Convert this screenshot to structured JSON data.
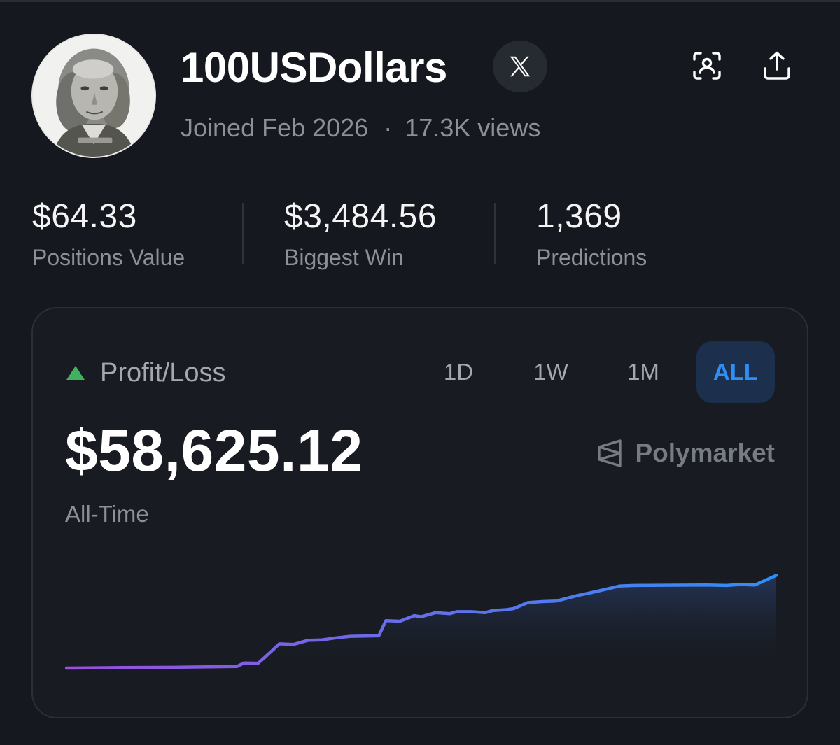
{
  "profile": {
    "username": "100USDollars",
    "joined": "Joined Feb 2026",
    "separator": "·",
    "views": "17.3K views"
  },
  "icons": {
    "avatar": "benjamin-franklin-portrait",
    "x_badge": "x-logo-icon",
    "scan": "face-scan-icon",
    "share": "share-upload-icon",
    "pl_trend": "triangle-up-icon",
    "brand": "polymarket-logo-icon"
  },
  "stats": [
    {
      "value": "$64.33",
      "label": "Positions Value"
    },
    {
      "value": "$3,484.56",
      "label": "Biggest Win"
    },
    {
      "value": "1,369",
      "label": "Predictions"
    }
  ],
  "card": {
    "title": "Profit/Loss",
    "tabs": [
      "1D",
      "1W",
      "1M",
      "ALL"
    ],
    "active_tab": "ALL",
    "value": "$58,625.12",
    "period": "All-Time",
    "brand": "Polymarket"
  },
  "colors": {
    "background": "#15181e",
    "accent_blue": "#2f8ff5",
    "positive_green": "#3fb15f",
    "line_start": "#9a4fe0",
    "line_end": "#2f8ff5"
  },
  "chart_data": {
    "type": "line",
    "title": "",
    "xlabel": "",
    "ylabel": "",
    "grid": false,
    "x": [
      0,
      8,
      16,
      24,
      25,
      27,
      28,
      30,
      32,
      34,
      36,
      38,
      40,
      44,
      45,
      47,
      49,
      50,
      52,
      54,
      55,
      57,
      59,
      60,
      62,
      63,
      65,
      67,
      69,
      72,
      74,
      78,
      80,
      90,
      93,
      95,
      97,
      100
    ],
    "series": [
      {
        "values": [
          0,
          0.5,
          0.8,
          1.5,
          5,
          4.8,
          11,
          24,
          23.5,
          27.5,
          28,
          30,
          31.5,
          32,
          47,
          46.5,
          52,
          51,
          55,
          54,
          56,
          56,
          55,
          57,
          58,
          59,
          65,
          66,
          66.5,
          72,
          75,
          81.5,
          82,
          82.5,
          82,
          83,
          82.5,
          92
        ]
      }
    ]
  }
}
